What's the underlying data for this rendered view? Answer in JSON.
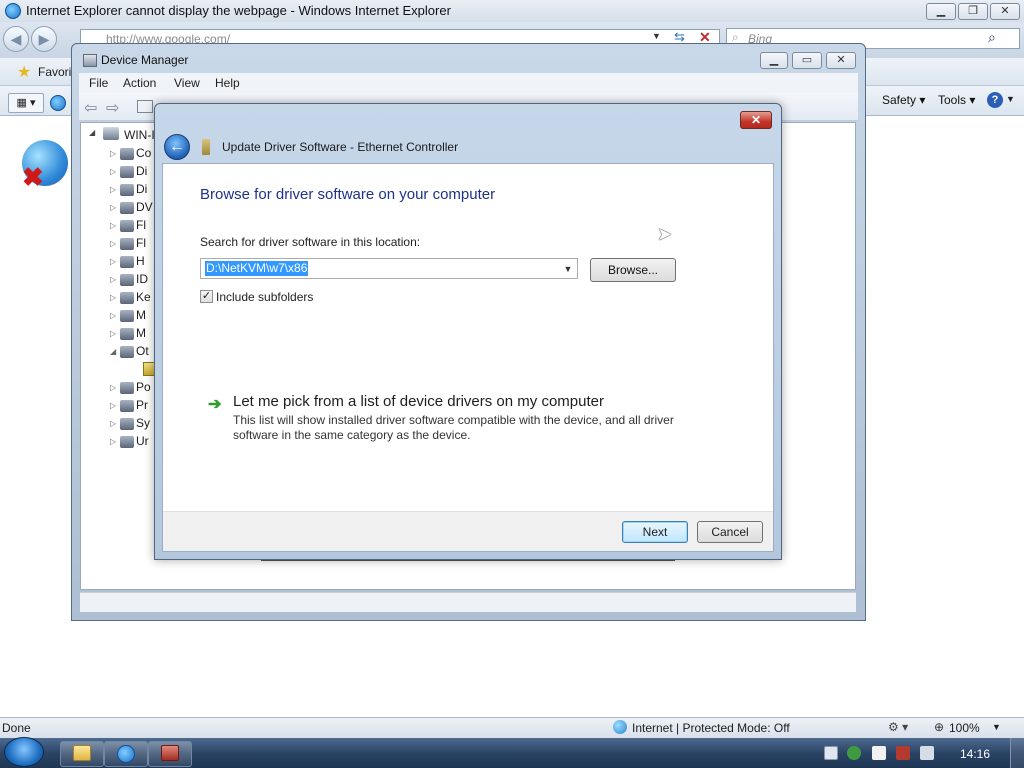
{
  "ie": {
    "title": "Internet Explorer cannot display the webpage - Windows Internet Explorer",
    "address": "http://www.google.com/",
    "search_placeholder": "Bing",
    "favorites_label": "Favori",
    "commands": {
      "safety": "Safety ▾",
      "tools": "Tools ▾",
      "help": "?"
    },
    "status": {
      "done": "Done",
      "zone": "Internet | Protected Mode: Off",
      "zoom": "100%"
    }
  },
  "device_manager": {
    "title": "Device Manager",
    "menu": [
      "File",
      "Action",
      "View",
      "Help"
    ],
    "tree": {
      "root": "WIN-I",
      "items": [
        "Co",
        "Di",
        "Di",
        "DV",
        "Fl",
        "Fl",
        "H",
        "ID",
        "Ke",
        "M",
        "M",
        "Ot",
        "",
        "Po",
        "Pr",
        "Sy",
        "Ur"
      ]
    }
  },
  "dialog": {
    "title": "Update Driver Software - Ethernet Controller",
    "heading": "Browse for driver software on your computer",
    "search_label": "Search for driver software in this location:",
    "path_value": "D:\\NetKVM\\w7\\x86",
    "browse_label": "Browse...",
    "include_subfolders": "Include subfolders",
    "include_subfolders_checked": true,
    "pick_link": "Let me pick from a list of device drivers on my computer",
    "pick_desc": "This list will show installed driver software compatible with the device, and all driver software in the same category as the device.",
    "next_label": "Next",
    "cancel_label": "Cancel",
    "close_glyph": "✕",
    "back_glyph": "←"
  },
  "taskbar": {
    "clock": "14:16"
  },
  "colors": {
    "heading_blue": "#1e3287",
    "selection": "#3399ff",
    "close_red": "#c2362a",
    "taskbar": "#2b4466"
  }
}
